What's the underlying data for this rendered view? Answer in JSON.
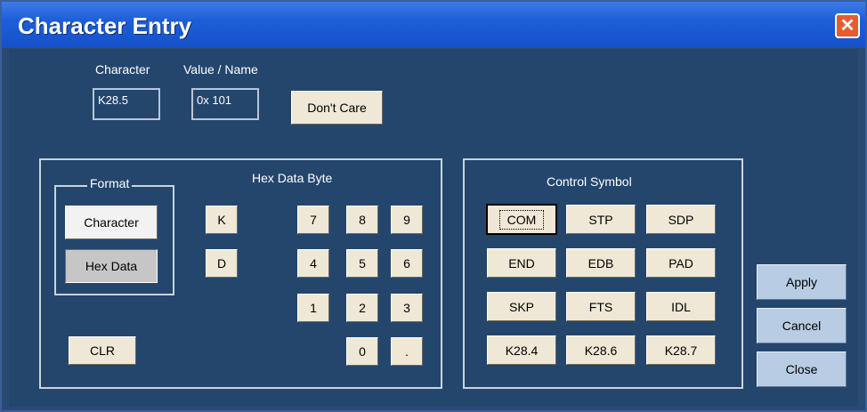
{
  "window": {
    "title": "Character Entry",
    "close_glyph": "✕"
  },
  "top": {
    "character_label": "Character",
    "value_label": "Value / Name",
    "character_value": "K28.5",
    "value_value": "0x 101",
    "dont_care": "Don't Care"
  },
  "hex_panel": {
    "title": "Hex Data Byte",
    "format_title": "Format",
    "format_character": "Character",
    "format_hex": "Hex Data",
    "k": "K",
    "d": "D",
    "keys": [
      "7",
      "8",
      "9",
      "4",
      "5",
      "6",
      "1",
      "2",
      "3",
      "0",
      "."
    ],
    "clr": "CLR"
  },
  "control_panel": {
    "title": "Control Symbol",
    "symbols": [
      "COM",
      "STP",
      "SDP",
      "END",
      "EDB",
      "PAD",
      "SKP",
      "FTS",
      "IDL",
      "K28.4",
      "K28.6",
      "K28.7"
    ]
  },
  "actions": {
    "apply": "Apply",
    "cancel": "Cancel",
    "close": "Close"
  },
  "colors": {
    "window_bg": "#24466d",
    "titlebar": "#1d5ed8",
    "button": "#efe8d6",
    "action_button": "#b8cde3"
  }
}
